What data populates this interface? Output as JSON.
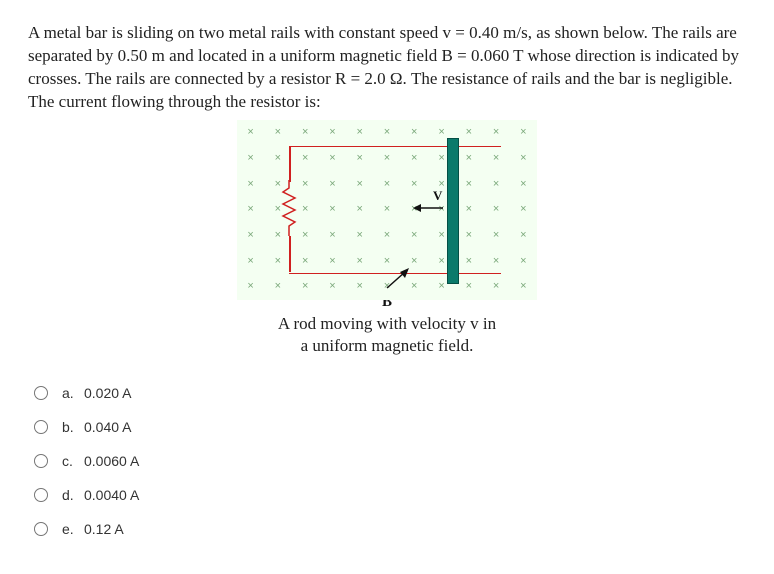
{
  "question": {
    "p1": "A metal bar is sliding on two metal rails with constant speed v = 0.40 m/s, as shown below. The rails are separated by 0.50 m and located in a uniform magnetic field B = 0.060 T whose direction is indicated by crosses. The rails are connected by a resistor R = 2.0 Ω. The resistance of rails and the bar is negligible. The current flowing through the resistor is:"
  },
  "diagram": {
    "v_label": "V",
    "b_label": "B",
    "caption_l1": "A rod moving with velocity v in",
    "caption_l2": "a uniform magnetic field."
  },
  "options": [
    {
      "letter": "a.",
      "text": "0.020 A"
    },
    {
      "letter": "b.",
      "text": "0.040 A"
    },
    {
      "letter": "c.",
      "text": "0.0060 A"
    },
    {
      "letter": "d.",
      "text": "0.0040 A"
    },
    {
      "letter": "e.",
      "text": "0.12 A"
    }
  ]
}
